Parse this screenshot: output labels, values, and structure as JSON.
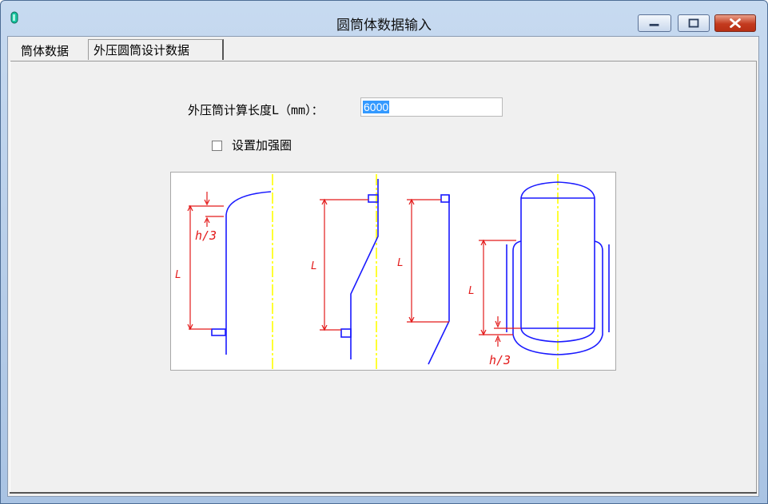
{
  "window": {
    "title": "圆筒体数据输入",
    "controls": {
      "minimize": "minimize",
      "maximize": "maximize",
      "close": "close"
    }
  },
  "tabs": [
    {
      "label": "筒体数据",
      "active": false
    },
    {
      "label": "外压圆筒设计数据",
      "active": true
    }
  ],
  "form": {
    "length_label": "外压筒计算长度L（mm）：",
    "length_value": "6000",
    "stiffener_label": "设置加强圈",
    "stiffener_checked": false
  },
  "diagram": {
    "labels": {
      "h_third": "h/3",
      "length": "L"
    },
    "colors": {
      "shell": "#1a1aff",
      "dimension": "#e31a1a",
      "centerline": "#ffff00"
    }
  },
  "icons": {
    "app": "cylinder-icon",
    "minimize": "minimize-icon",
    "maximize": "maximize-icon",
    "close": "close-icon"
  }
}
